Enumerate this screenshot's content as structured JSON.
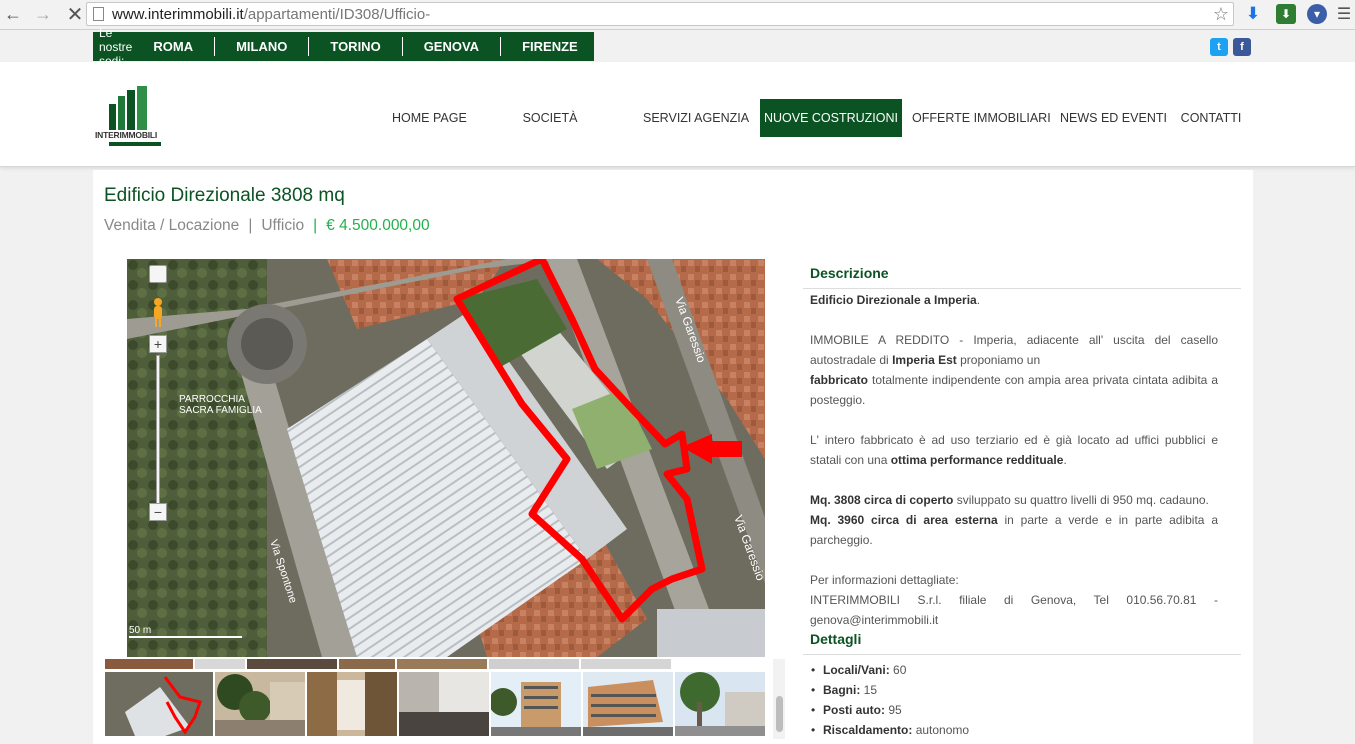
{
  "browser": {
    "url_host": "www.interimmobili.it",
    "url_path": "/appartamenti/ID308/Ufficio-",
    "back_icon": "arrow-left-icon",
    "forward_icon": "arrow-right-icon",
    "stop_icon": "close-icon",
    "star_icon": "star-icon"
  },
  "offices": {
    "label": "Le nostre sedi:",
    "items": [
      "ROMA",
      "MILANO",
      "TORINO",
      "GENOVA",
      "FIRENZE"
    ]
  },
  "social": {
    "twitter": "t",
    "facebook": "f"
  },
  "logo": {
    "text": "INTERIMMOBILI"
  },
  "nav": {
    "items": [
      "HOME PAGE",
      "SOCIETÀ",
      "SERVIZI AGENZIA",
      "NUOVE COSTRUZIONI",
      "OFFERTE IMMOBILIARI",
      "NEWS ED EVENTI",
      "CONTATTI"
    ],
    "active": "NUOVE COSTRUZIONI"
  },
  "listing": {
    "title": "Edificio Direzionale 3808 mq",
    "type": "Vendita / Locazione",
    "category": "Ufficio",
    "price": "€ 4.500.000,00"
  },
  "map": {
    "labels": [
      "PARROCCHIA",
      "SACRA FAMIGLIA",
      "Via Garessio",
      "Via Garessio",
      "Via Spontone"
    ],
    "scale": "50 m",
    "zoom_in": "+",
    "zoom_out": "−"
  },
  "description": {
    "heading": "Descrizione",
    "p1_bold": "Edificio Direzionale a Imperia",
    "p1_end": ".",
    "p2_a": "IMMOBILE A REDDITO - Imperia, adiacente all' uscita del casello autostradale di ",
    "p2_b": "Imperia Est",
    "p2_c": " proponiamo un",
    "p3_a": "fabbricato",
    "p3_b": " totalmente indipendente con ampia area privata cintata adibita a posteggio.",
    "p4_a": "L' intero fabbricato è ad uso terziario ed è già locato ad uffici pubblici e statali con una ",
    "p4_b": "ottima performance reddituale",
    "p4_c": ".",
    "p5_a": "Mq. 3808 circa di coperto",
    "p5_b": " sviluppato su quattro livelli di 950 mq. cadauno.",
    "p6_a": "Mq. 3960 circa di area esterna",
    "p6_b": " in parte a verde e in parte adibita a parcheggio.",
    "p7": "Per informazioni dettagliate:",
    "p8": "INTERIMMOBILI S.r.l. filiale di Genova, Tel 010.56.70.81 - genova@interimmobili.it"
  },
  "details": {
    "heading": "Dettagli",
    "items": [
      {
        "label": "Locali/Vani:",
        "value": " 60"
      },
      {
        "label": "Bagni:",
        "value": " 15"
      },
      {
        "label": "Posti auto:",
        "value": " 95"
      },
      {
        "label": "Riscaldamento:",
        "value": " autonomo"
      }
    ]
  },
  "colors": {
    "brand_green": "#0b5323",
    "price_green": "#22b14c",
    "outline_red": "#ff0000"
  }
}
